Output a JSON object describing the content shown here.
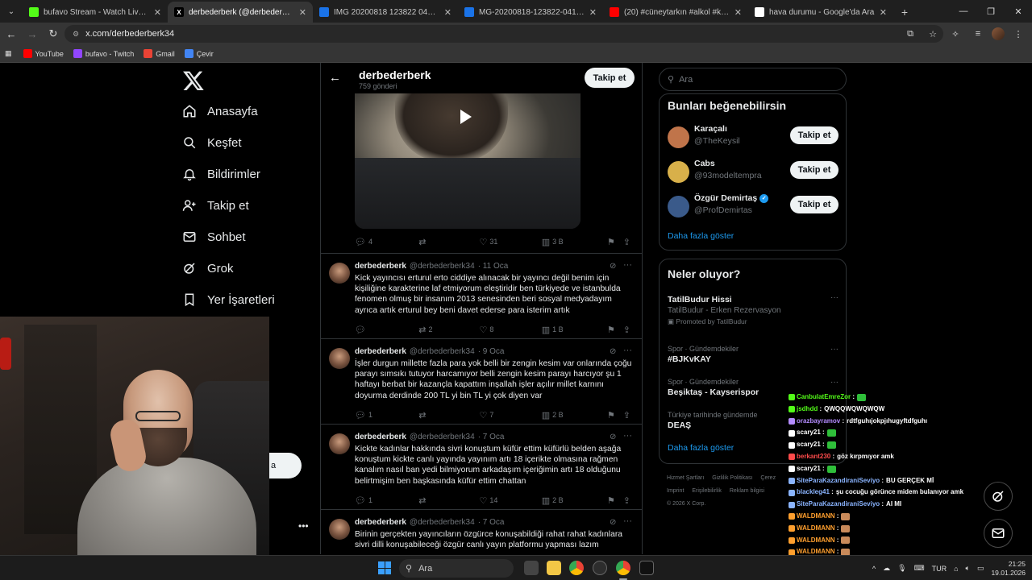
{
  "browser": {
    "tabs": [
      {
        "label": "bufavo Stream - Watch Live on",
        "icon": "kick-icon",
        "color": "#53fc18",
        "active": false
      },
      {
        "label": "derbederberk (@derbederberk)",
        "icon": "x-icon",
        "color": "#000000",
        "active": true
      },
      {
        "label": "IMG 20200818 123822 041 ho",
        "icon": "image-icon",
        "color": "#1a73e8",
        "active": false
      },
      {
        "label": "MG-20200818-123822-041.we",
        "icon": "image-icon",
        "color": "#1a73e8",
        "active": false
      },
      {
        "label": "(20) #cüneytarkın #alkol #keşfe",
        "icon": "youtube-icon",
        "color": "#ff0000",
        "active": false
      },
      {
        "label": "hava durumu - Google'da Ara",
        "icon": "google-icon",
        "color": "#ffffff",
        "active": false
      }
    ],
    "url": "x.com/derbederberk34",
    "bookmarks": [
      {
        "label": "YouTube",
        "color": "#ff0000"
      },
      {
        "label": "bufavo - Twitch",
        "color": "#9146ff"
      },
      {
        "label": "Gmail",
        "color": "#ea4335"
      },
      {
        "label": "Çevir",
        "color": "#4285f4"
      }
    ]
  },
  "nav": {
    "items": [
      "Anasayfa",
      "Keşfet",
      "Bildirimler",
      "Takip et",
      "Sohbet",
      "Grok",
      "Yer İşaretleri"
    ]
  },
  "profile_header": {
    "name": "derbederberk",
    "post_count": "759 gönderi",
    "follow_label": "Takip et"
  },
  "video_post_stats": {
    "replies": "4",
    "reposts": "",
    "likes": "31",
    "views": "3 B"
  },
  "tweets": [
    {
      "name": "derbederberk",
      "handle": "@derbederberk34",
      "date": "· 11 Oca",
      "text": "Kick yayıncısı erturul erto  ciddiye alınacak bir yayıncı değil benim için kişiliğine karakterine laf etmiyorum eleştiridir ben türkiyede ve istanbulda fenomen olmuş bir insanım 2013 senesinden beri sosyal medyadayım ayrıca artık erturul bey beni davet ederse para isterim artık",
      "replies": "",
      "reposts": "2",
      "likes": "8",
      "views": "1 B"
    },
    {
      "name": "derbederberk",
      "handle": "@derbederberk34",
      "date": "· 9 Oca",
      "text": "İşler durgun millette fazla para yok belli bir zengin kesim var onlarında çoğu parayı sımsıkı tutuyor harcamıyor belli zengin kesim parayı harcıyor şu 1 haftayı berbat bir kazançla kapattım inşallah işler açılır millet karnını doyurma derdinde 200 TL yi bin TL yi çok diyen var",
      "replies": "1",
      "reposts": "",
      "likes": "7",
      "views": "2 B"
    },
    {
      "name": "derbederberk",
      "handle": "@derbederberk34",
      "date": "· 7 Oca",
      "text": "Kickte kadınlar hakkında sivri konuştum küfür ettim küfürlü belden aşağa konuştum kickte canlı yayında yayınım artı 18 içerikte olmasına rağmen kanalım nasıl ban yedi bilmiyorum arkadaşım içeriğimin artı 18 olduğunu belirtmişim ben başkasında küfür ettim chattan",
      "replies": "1",
      "reposts": "",
      "likes": "14",
      "views": "2 B"
    },
    {
      "name": "derbederberk",
      "handle": "@derbederberk34",
      "date": "· 7 Oca",
      "text": "Birinin gerçekten  yayıncıların özgürce konuşabildiği rahat rahat kadınlara sivri dilli konuşabileceği özgür canlı yayın platformu yapması lazım",
      "replies": "",
      "reposts": "",
      "likes": "",
      "views": ""
    }
  ],
  "right": {
    "search_placeholder": "Ara",
    "who_to_follow": {
      "title": "Bunları beğenebilirsin",
      "users": [
        {
          "name": "Karaçalı",
          "handle": "@TheKeysil",
          "verified": false,
          "color": "#c0744a"
        },
        {
          "name": "Cabs",
          "handle": "@93modeltempra",
          "verified": false,
          "color": "#d8b04a"
        },
        {
          "name": "Özgür Demirtaş",
          "handle": "@ProfDemirtas",
          "verified": true,
          "color": "#3a5a8a"
        }
      ],
      "follow_label": "Takip et",
      "show_more": "Daha fazla göster"
    },
    "trends": {
      "title": "Neler oluyor?",
      "items": [
        {
          "category": "",
          "title": "TatilBudur Hissi",
          "subtitle": "TatilBudur - Erken Rezervasyon",
          "promoted": "Promoted by TatilBudur"
        },
        {
          "category": "Spor · Gündemdekiler",
          "title": "#BJKvKAY",
          "subtitle": "",
          "promoted": ""
        },
        {
          "category": "Spor · Gündemdekiler",
          "title": "Beşiktaş - Kayserispor",
          "subtitle": "",
          "promoted": ""
        },
        {
          "category": "Türkiye tarihinde gündemde",
          "title": "DEAŞ",
          "subtitle": "",
          "promoted": ""
        }
      ],
      "show_more": "Daha fazla göster"
    },
    "footer": [
      "Hizmet Şartları",
      "Gizlilik Politikası",
      "Çerez",
      "Imprint",
      "Erişilebilirlik",
      "Reklam bilgisi",
      "© 2026 X Corp."
    ]
  },
  "chat": [
    {
      "user": "CanbulatEmreZor",
      "color": "#53fc18",
      "msg": ""
    },
    {
      "user": "jsdhdd",
      "color": "#53fc18",
      "msg": "QWQQWQWQWQW"
    },
    {
      "user": "orazbayramov",
      "color": "#b48cff",
      "msg": "rdtfguhıjokpjıhugyftdfguhı"
    },
    {
      "user": "scary21",
      "color": "#ffffff",
      "msg": ""
    },
    {
      "user": "scary21",
      "color": "#ffffff",
      "msg": ""
    },
    {
      "user": "berkant230",
      "color": "#ff4b4b",
      "msg": "göz kırpmıyor amk"
    },
    {
      "user": "scary21",
      "color": "#ffffff",
      "msg": ""
    },
    {
      "user": "SiteParaKazandiraniSeviyo",
      "color": "#8ab4ff",
      "msg": "BU GERÇEK Mİ"
    },
    {
      "user": "blackleg41",
      "color": "#8ab4ff",
      "msg": "şu cocuğu görünce midem bulanıyor amk"
    },
    {
      "user": "SiteParaKazandiraniSeviyo",
      "color": "#8ab4ff",
      "msg": "AI MI"
    },
    {
      "user": "WALDMANN",
      "color": "#ff9f2e",
      "msg": ""
    },
    {
      "user": "WALDMANN",
      "color": "#ff9f2e",
      "msg": ""
    },
    {
      "user": "WALDMANN",
      "color": "#ff9f2e",
      "msg": ""
    },
    {
      "user": "WALDMANN",
      "color": "#ff9f2e",
      "msg": ""
    },
    {
      "user": "WALDMANN",
      "color": "#ff9f2e",
      "msg": ""
    }
  ],
  "taskbar": {
    "search_placeholder": "Ara",
    "language": "TUR",
    "time": "21:25",
    "date": "19.01.2026"
  }
}
